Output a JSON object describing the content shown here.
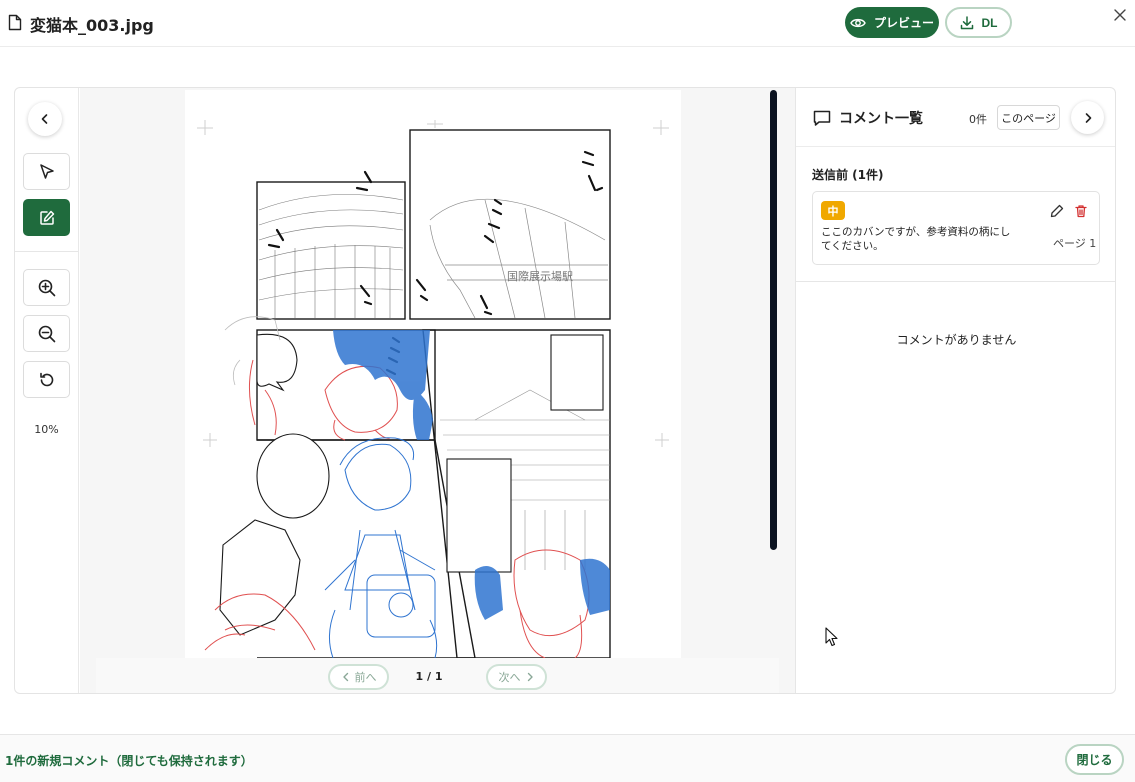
{
  "header": {
    "file_name": "変猫本_003.jpg",
    "preview_label": "プレビュー",
    "download_label": "DL"
  },
  "toolbar": {
    "zoom_level": "10%"
  },
  "pager": {
    "prev_label": "前へ",
    "next_label": "次へ",
    "page_indicator": "1 / 1"
  },
  "comments_panel": {
    "title": "コメント一覧",
    "count": "0件",
    "this_page_label": "このページ",
    "pending_section": "送信前 (1件)",
    "pending_comments": [
      {
        "priority": "中",
        "text": "ここのカバンですが、参考資料の柄にしてください。",
        "page": "ページ 1"
      }
    ],
    "empty_message": "コメントがありません"
  },
  "footer": {
    "message": "1件の新規コメント（閉じても保持されます）",
    "close_label": "閉じる"
  },
  "colors": {
    "accent": "#1f6b3d",
    "priority_medium": "#f0a800",
    "delete": "#d32f2f",
    "sketch_red": "#e05050",
    "sketch_blue": "#2f74d0"
  }
}
